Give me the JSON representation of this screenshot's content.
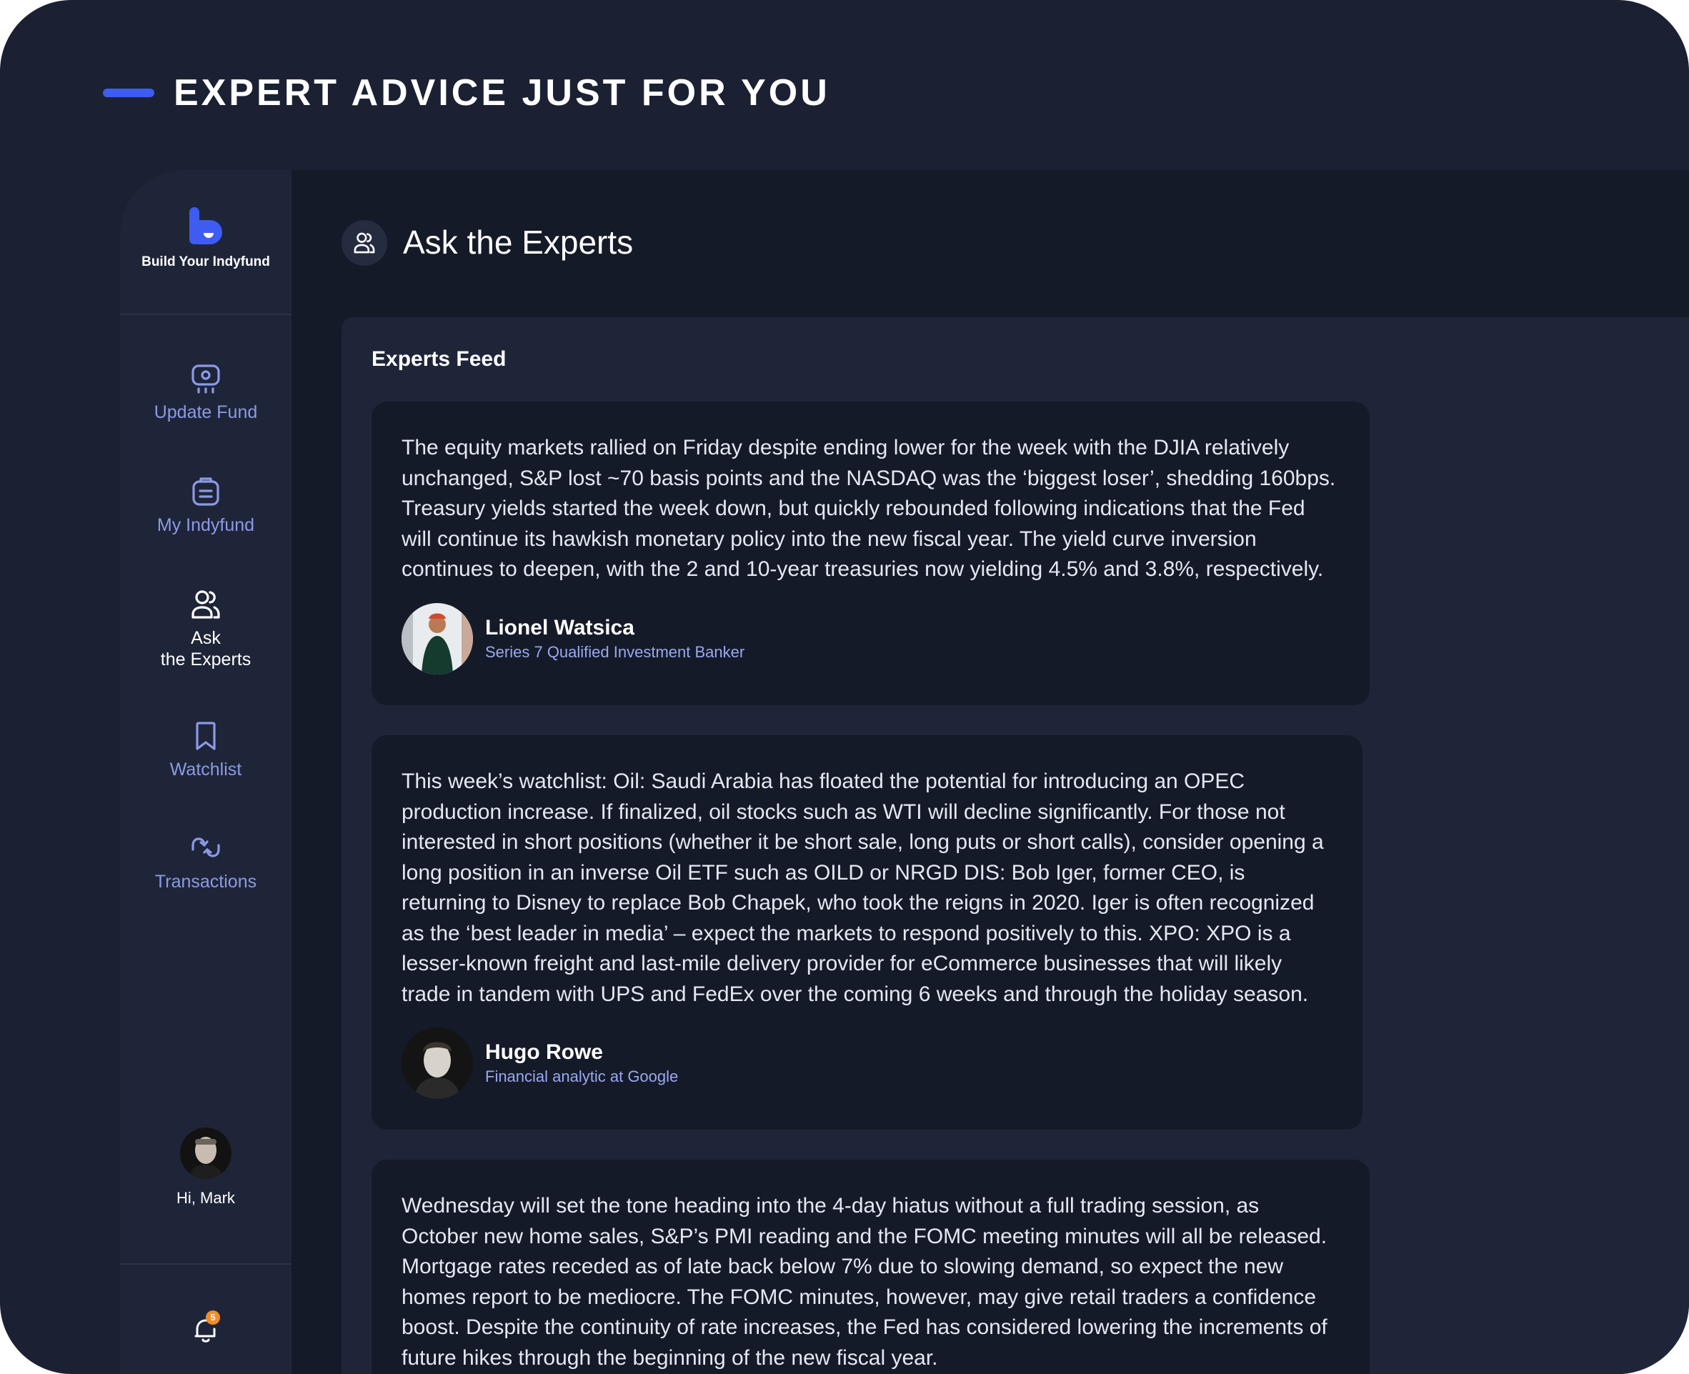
{
  "headline": "EXPERT ADVICE JUST FOR YOU",
  "brand": {
    "name": "Build Your Indyfund",
    "icon": "indyfund-logo-icon",
    "accent": "#3e5cf2"
  },
  "nav": [
    {
      "label": "Update Fund",
      "icon": "presentation-board-icon"
    },
    {
      "label": "My Indyfund",
      "icon": "clipboard-icon"
    },
    {
      "label_line1": "Ask",
      "label_line2": "the Experts",
      "icon": "users-icon",
      "active": true
    },
    {
      "label": "Watchlist",
      "icon": "bookmark-icon"
    },
    {
      "label": "Transactions",
      "icon": "arrows-exchange-icon"
    }
  ],
  "user": {
    "greeting": "Hi, Mark"
  },
  "notifications": {
    "count": "5",
    "icon": "bell-icon"
  },
  "page": {
    "title": "Ask the Experts",
    "icon": "users-icon"
  },
  "feed": {
    "title": "Experts Feed",
    "posts": [
      {
        "text": "The equity markets rallied on Friday despite ending lower for the week with the DJIA relatively unchanged, S&P lost ~70 basis points and the NASDAQ was the ‘biggest loser’, shedding 160bps. Treasury yields started the week down, but quickly rebounded following indications that the Fed will continue its hawkish monetary policy into the new fiscal year. The yield curve inversion continues to deepen, with the 2 and 10-year treasuries now yielding 4.5% and 3.8%, respectively.",
        "author": "Lionel Watsica",
        "role": "Series 7 Qualified Investment Banker"
      },
      {
        "text": "This week’s watchlist: Oil: Saudi Arabia has floated the potential for introducing an OPEC production increase. If finalized, oil stocks such as WTI will decline significantly. For those not interested in short positions (whether it be short sale, long puts or short calls), consider opening a long position in an inverse Oil ETF such as OILD or NRGD DIS: Bob Iger, former CEO, is returning to Disney to replace Bob Chapek, who took the reigns in 2020. Iger is often recognized as the ‘best leader in media’ – expect the markets to respond positively to this. XPO: XPO is a lesser-known freight and last-mile delivery provider for eCommerce businesses that will likely trade in tandem with UPS and FedEx over the coming 6 weeks and through the holiday season.",
        "author": "Hugo Rowe",
        "role": "Financial analytic at Google"
      },
      {
        "text": "Wednesday will set the tone heading into the 4-day hiatus without a full trading session, as October new home sales, S&P’s PMI reading and the FOMC meeting minutes will all be released. Mortgage rates receded as of late back below 7% due to slowing demand, so expect the new homes report to be mediocre. The FOMC minutes, however, may give retail traders a confidence boost. Despite the continuity of rate increases, the Fed has considered lowering the increments of future hikes through the beginning of the new fiscal year."
      }
    ]
  }
}
